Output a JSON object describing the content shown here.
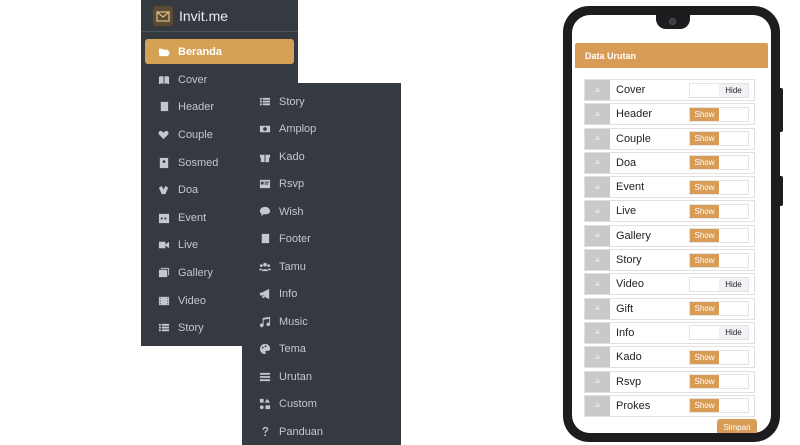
{
  "brand": {
    "name": "Invit.me"
  },
  "menu_primary": [
    {
      "label": "Beranda",
      "icon": "folder-open-icon",
      "active": true
    },
    {
      "label": "Cover",
      "icon": "book-open-icon"
    },
    {
      "label": "Header",
      "icon": "book-icon"
    },
    {
      "label": "Couple",
      "icon": "heart-icon"
    },
    {
      "label": "Sosmed",
      "icon": "contact-book-icon"
    },
    {
      "label": "Doa",
      "icon": "praying-hands-icon"
    },
    {
      "label": "Event",
      "icon": "calendar-icon"
    },
    {
      "label": "Live",
      "icon": "video-camera-icon"
    },
    {
      "label": "Gallery",
      "icon": "images-icon"
    },
    {
      "label": "Video",
      "icon": "film-icon"
    },
    {
      "label": "Story",
      "icon": "list-icon"
    }
  ],
  "menu_secondary": [
    {
      "label": "Story",
      "icon": "list-icon"
    },
    {
      "label": "Amplop",
      "icon": "money-icon"
    },
    {
      "label": "Kado",
      "icon": "gift-icon"
    },
    {
      "label": "Rsvp",
      "icon": "id-card-icon"
    },
    {
      "label": "Wish",
      "icon": "comment-icon"
    },
    {
      "label": "Footer",
      "icon": "book-icon"
    },
    {
      "label": "Tamu",
      "icon": "users-icon"
    },
    {
      "label": "Info",
      "icon": "bullhorn-icon"
    },
    {
      "label": "Music",
      "icon": "music-icon"
    },
    {
      "label": "Tema",
      "icon": "palette-icon"
    },
    {
      "label": "Urutan",
      "icon": "bars-icon"
    },
    {
      "label": "Custom",
      "icon": "shapes-icon"
    },
    {
      "label": "Panduan",
      "icon": "question-icon"
    }
  ],
  "phone": {
    "card_title": "Data Urutan",
    "rows": [
      {
        "label": "Cover",
        "state": "Hide"
      },
      {
        "label": "Header",
        "state": "Show"
      },
      {
        "label": "Couple",
        "state": "Show"
      },
      {
        "label": "Doa",
        "state": "Show"
      },
      {
        "label": "Event",
        "state": "Show"
      },
      {
        "label": "Live",
        "state": "Show"
      },
      {
        "label": "Gallery",
        "state": "Show"
      },
      {
        "label": "Story",
        "state": "Show"
      },
      {
        "label": "Video",
        "state": "Hide"
      },
      {
        "label": "Gift",
        "state": "Show"
      },
      {
        "label": "Info",
        "state": "Hide"
      },
      {
        "label": "Kado",
        "state": "Show"
      },
      {
        "label": "Rsvp",
        "state": "Show"
      },
      {
        "label": "Prokes",
        "state": "Show"
      }
    ],
    "save_label": "Simpan",
    "handle_glyph": "≡"
  },
  "colors": {
    "sidebar_bg": "#343a40",
    "accent": "#d4a155",
    "menu_text": "#c2c7d0"
  }
}
